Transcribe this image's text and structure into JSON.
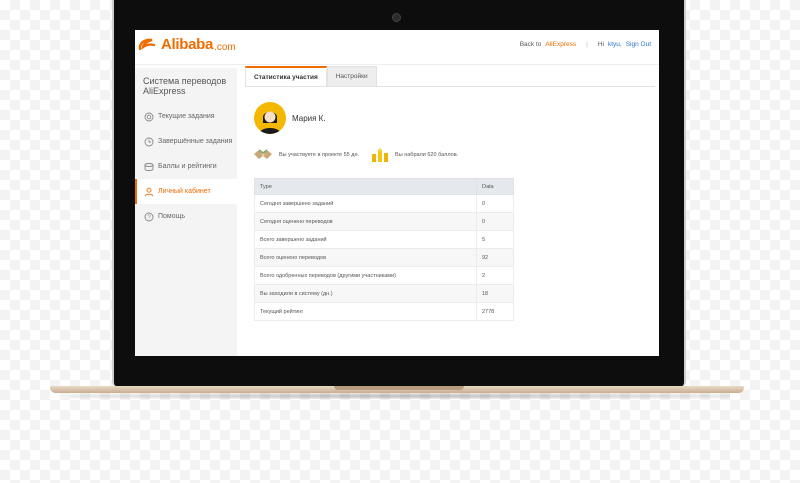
{
  "header": {
    "logo_text": "Alibaba",
    "logo_domain": ".com",
    "back_prefix": "Back to",
    "back_link": "AliExpress",
    "greeting_prefix": "Hi",
    "user_link": "ktyu,",
    "signout": "Sign Out"
  },
  "sidebar": {
    "title_line1": "Система переводов",
    "title_line2": "AliExpress",
    "items": [
      {
        "label": "Текущие задания",
        "icon": "target-icon"
      },
      {
        "label": "Завершённые задания",
        "icon": "clock-icon"
      },
      {
        "label": "Баллы и рейтинги",
        "icon": "coins-icon"
      },
      {
        "label": "Личный кабинет",
        "icon": "user-icon",
        "active": true
      },
      {
        "label": "Помощь",
        "icon": "help-icon"
      }
    ]
  },
  "tabs": [
    {
      "label": "Статистика участия",
      "active": true
    },
    {
      "label": "Настройки",
      "active": false
    }
  ],
  "profile": {
    "name": "Мария К.",
    "stat_days": "Вы участвуете в проекте 55 дн.",
    "stat_points": "Вы набрали 620 баллов."
  },
  "table": {
    "headers": [
      "Type",
      "Data"
    ],
    "rows": [
      [
        "Сегодня завершено заданий",
        "0"
      ],
      [
        "Сегодня оценено переводов",
        "0"
      ],
      [
        "Всего завершено заданий",
        "5"
      ],
      [
        "Всего оценено переводов",
        "92"
      ],
      [
        "Всего одобренных переводов (другими участниками)",
        "2"
      ],
      [
        "Вы заходили в систему (дн.)",
        "18"
      ],
      [
        "Текущий рейтинг",
        "2778"
      ]
    ]
  },
  "colors": {
    "accent": "#ef6c00",
    "link": "#2a73c5",
    "avatar": "#f5b800"
  }
}
